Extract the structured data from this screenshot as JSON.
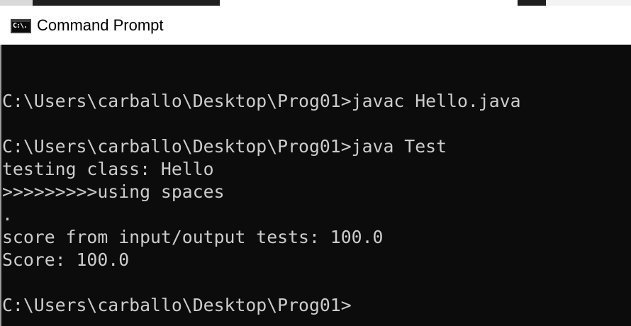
{
  "window": {
    "title": "Command Prompt",
    "icon": "cmd-icon",
    "icon_label": "C:\\."
  },
  "console": {
    "lines": [
      "",
      "C:\\Users\\carballo\\Desktop\\Prog01>javac Hello.java",
      "",
      "C:\\Users\\carballo\\Desktop\\Prog01>java Test",
      "testing class: Hello",
      ">>>>>>>>>using spaces",
      ".",
      "score from input/output tests: 100.0",
      "Score: 100.0",
      "",
      "C:\\Users\\carballo\\Desktop\\Prog01>"
    ]
  },
  "colors": {
    "console_background": "#0c0c0c",
    "console_text": "#cccccc",
    "titlebar_background": "#ffffff",
    "title_text": "#000000"
  }
}
